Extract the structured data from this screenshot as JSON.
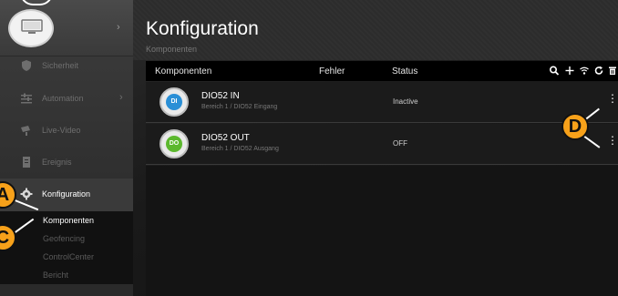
{
  "sidebar": {
    "device_chevron": "›",
    "items": [
      {
        "label": "Sicherheit",
        "icon": "shield-icon",
        "chevron": ""
      },
      {
        "label": "Automation",
        "icon": "sliders-icon",
        "chevron": "›"
      },
      {
        "label": "Live-Video",
        "icon": "camera-icon",
        "chevron": ""
      },
      {
        "label": "Ereignis",
        "icon": "document-icon",
        "chevron": ""
      },
      {
        "label": "Konfiguration",
        "icon": "gear-icon",
        "chevron": ""
      }
    ],
    "submenu": [
      "Komponenten",
      "Geofencing",
      "ControlCenter",
      "Bericht"
    ]
  },
  "header": {
    "title": "Konfiguration",
    "subtitle": "Komponenten"
  },
  "table": {
    "columns": [
      "Komponenten",
      "Fehler",
      "Status"
    ],
    "tools": [
      "search-icon",
      "plus-icon",
      "wifi-icon",
      "refresh-icon",
      "trash-icon"
    ],
    "rows": [
      {
        "name": "DIO52 IN",
        "desc": "Bereich 1 / DIO52 Eingang",
        "status": "Inactive",
        "badge": "DI",
        "badge_color": "#2a8fd6"
      },
      {
        "name": "DIO52 OUT",
        "desc": "Bereich 1 / DIO52 Ausgang",
        "status": "OFF",
        "badge": "DO",
        "badge_color": "#5cb82e"
      }
    ]
  },
  "annotations": [
    "A",
    "C",
    "D"
  ],
  "colors": {
    "marker": "#f7a11a",
    "accent_in": "#2a8fd6",
    "accent_out": "#5cb82e"
  }
}
